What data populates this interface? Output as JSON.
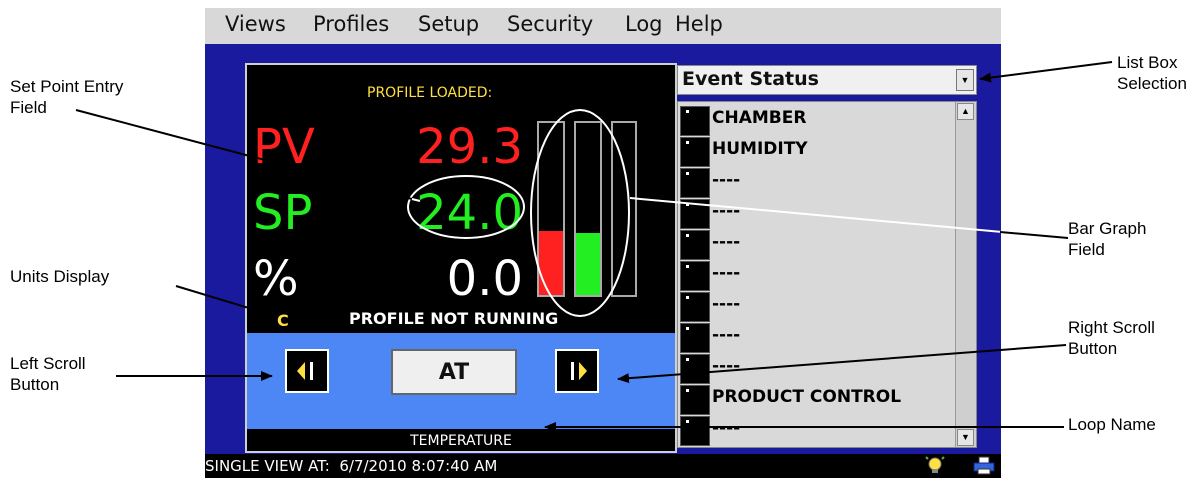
{
  "menu": {
    "items": [
      "Views",
      "Profiles",
      "Setup",
      "Security",
      "Log",
      "Help"
    ]
  },
  "loop_panel": {
    "profile_loaded_label": "PROFILE LOADED:",
    "pv_label": "PV",
    "pv_value": "29.3",
    "sp_label": "SP",
    "sp_value": "24.0",
    "pct_label": "%",
    "pct_value": "0.0",
    "units": "C",
    "profile_status": "PROFILE NOT RUNNING",
    "at_button": "AT",
    "loop_name": "TEMPERATURE",
    "bar_pv_fill": 0.37,
    "bar_sp_fill": 0.36,
    "bar_pct_fill": 0.0,
    "colors": {
      "pv": "#ff2020",
      "sp": "#22ee22",
      "pct": "#ffffff",
      "loaded": "#ffe040",
      "units": "#ffe040"
    }
  },
  "event_panel": {
    "selection": "Event Status",
    "events": [
      "CHAMBER",
      "HUMIDITY",
      "----",
      "----",
      "----",
      "----",
      "----",
      "----",
      "----",
      "PRODUCT CONTROL",
      "----"
    ]
  },
  "statusbar": {
    "text": "SINGLE VIEW AT:  6/7/2010 8:07:40 AM"
  },
  "callouts": {
    "set_point": "Set Point Entry\nField",
    "units_display": "Units Display",
    "left_scroll": "Left Scroll\nButton",
    "list_box": "List Box\nSelection",
    "bar_graph": "Bar Graph\nField",
    "right_scroll": "Right Scroll\nButton",
    "loop_name": "Loop Name"
  }
}
